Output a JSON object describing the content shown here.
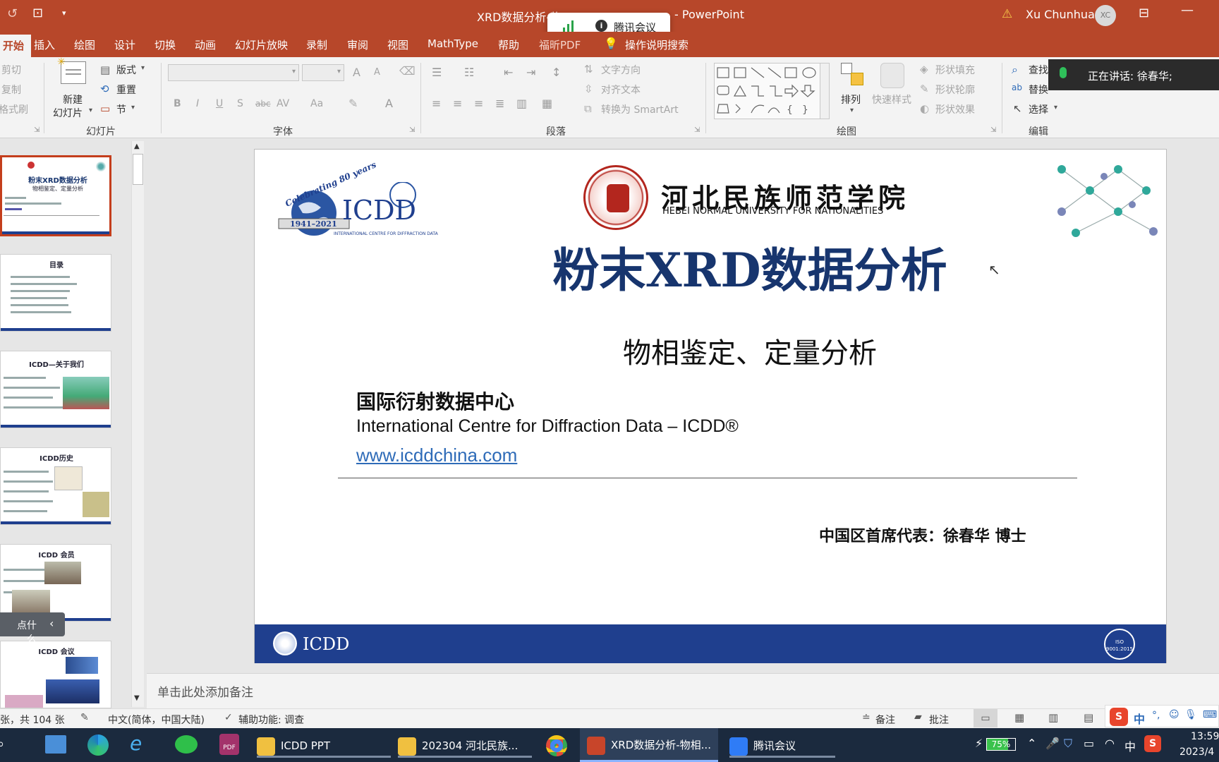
{
  "titlebar": {
    "doc_title": "XRD数据分析-物",
    "app_suffix": "- PowerPoint",
    "user_name": "Xu Chunhua",
    "user_initials": "XC",
    "warning_icon": "warning-icon",
    "color": "#b7472a"
  },
  "meeting_pill": {
    "label": "腾讯会议",
    "icon": "signal-icon"
  },
  "tabs": [
    {
      "label": "开始",
      "active": true
    },
    {
      "label": "插入"
    },
    {
      "label": "绘图"
    },
    {
      "label": "设计"
    },
    {
      "label": "切换"
    },
    {
      "label": "动画"
    },
    {
      "label": "幻灯片放映"
    },
    {
      "label": "录制"
    },
    {
      "label": "审阅"
    },
    {
      "label": "视图"
    },
    {
      "label": "MathType"
    },
    {
      "label": "帮助"
    },
    {
      "label": "福昕PDF"
    },
    {
      "label": "操作说明搜索"
    }
  ],
  "ribbon": {
    "clipboard": {
      "cut": "剪切",
      "copy": "复制",
      "format_painter": "格式刷"
    },
    "slides": {
      "new_slide": "新建",
      "new_slide2": "幻灯片",
      "layout": "版式",
      "reset": "重置",
      "section": "节",
      "group": "幻灯片"
    },
    "font": {
      "group": "字体",
      "bold": "B",
      "italic": "I",
      "underline": "U",
      "shadow": "S",
      "strike": "abc",
      "spacing": "AV",
      "case": "Aa",
      "grow": "A",
      "shrink": "A"
    },
    "paragraph": {
      "group": "段落",
      "text_direction": "文字方向",
      "align_text": "对齐文本",
      "smartart": "转换为 SmartArt"
    },
    "drawing": {
      "group": "绘图",
      "arrange": "排列",
      "quick_styles": "快速样式",
      "shape_fill": "形状填充",
      "shape_outline": "形状轮廓",
      "shape_effects": "形状效果"
    },
    "editing": {
      "group": "编辑",
      "find": "查找",
      "replace": "替换",
      "select": "选择"
    }
  },
  "speaking": {
    "text": "正在讲话: 徐春华;"
  },
  "thumbnails": [
    {
      "title": "粉末XRD数据分析",
      "sub": "物相鉴定、定量分析",
      "selected": true
    },
    {
      "title": "目录"
    },
    {
      "title": "ICDD—关于我们"
    },
    {
      "title": "ICDD历史"
    },
    {
      "title": "ICDD 会员"
    },
    {
      "title": "ICDD 会议"
    }
  ],
  "collapse_tip": "点什么...",
  "slide": {
    "university_cn": "河北民族师范学院",
    "university_en": "HEBEI NORMAL UNIVERSITY FOR NATIONALITIES",
    "icdd_logo_text": "ICDD",
    "icdd_sub": "INTERNATIONAL CENTRE FOR DIFFRACTION DATA",
    "celebrating": "Celebrating 80 years",
    "years": "1941–2021",
    "title": "粉末XRD数据分析",
    "subtitle": "物相鉴定、定量分析",
    "org_cn": "国际衍射数据中心",
    "org_en": "International Centre for Diffraction Data – ICDD®",
    "website": "www.icddchina.com",
    "presenter": "中国区首席代表：徐春华 博士",
    "footer_logo": "ICDD",
    "iso_badge": "ISO 9001:2015",
    "accent": "#1f3f8e",
    "title_color": "#17356e"
  },
  "notes_placeholder": "单击此处添加备注",
  "statusbar": {
    "slide_count": "张，共 104 张",
    "language": "中文(简体，中国大陆)",
    "accessibility": "辅助功能: 调查",
    "notes": "备注",
    "comments": "批注"
  },
  "taskbar": {
    "items": [
      {
        "label": "ICDD  PPT",
        "icon": "folder-icon"
      },
      {
        "label": "202304 河北民族...",
        "icon": "folder-icon"
      },
      {
        "label": "XRD数据分析-物相...",
        "icon": "powerpoint-icon"
      },
      {
        "label": "腾讯会议",
        "icon": "meeting-icon"
      }
    ],
    "battery": "75%",
    "ime": "中",
    "time": "13:59",
    "date": "2023/4"
  }
}
